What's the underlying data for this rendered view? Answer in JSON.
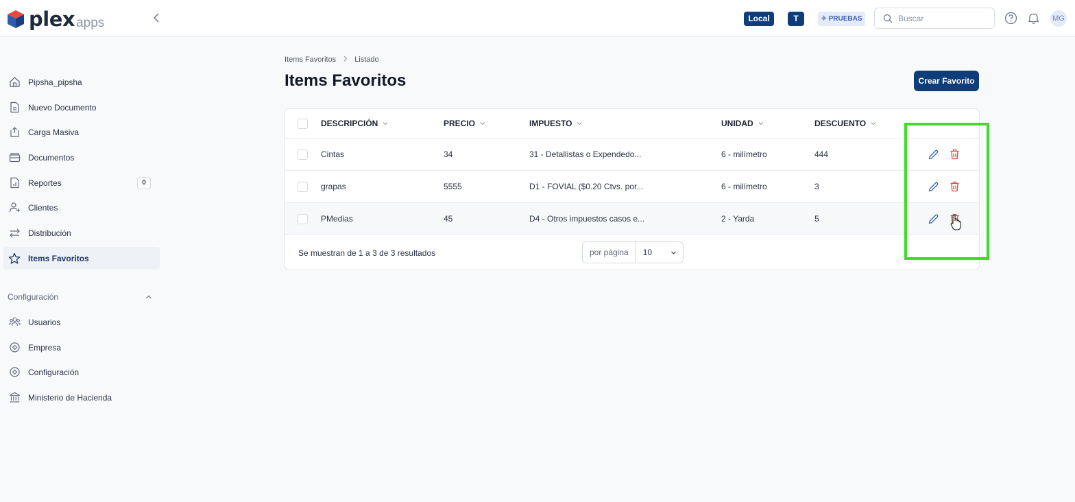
{
  "brand": {
    "name": "plex",
    "suffix": "apps"
  },
  "topbar": {
    "env_local": "Local",
    "env_t": "T",
    "env_pruebas": "✧ PRUEBAS",
    "search_placeholder": "Buscar",
    "avatar": "MG"
  },
  "sidebar": {
    "items": [
      {
        "label": "Pipsha_pipsha",
        "icon": "home-icon"
      },
      {
        "label": "Nuevo Documento",
        "icon": "document-icon"
      },
      {
        "label": "Carga Masiva",
        "icon": "upload-icon"
      },
      {
        "label": "Documentos",
        "icon": "folder-icon"
      },
      {
        "label": "Reportes",
        "icon": "report-icon",
        "badge": "0"
      },
      {
        "label": "Clientes",
        "icon": "add-user-icon"
      },
      {
        "label": "Distribución",
        "icon": "transfer-icon"
      },
      {
        "label": "Items Favoritos",
        "icon": "star-icon",
        "active": true
      }
    ],
    "config_section": "Configuración",
    "config_items": [
      {
        "label": "Usuarios",
        "icon": "users-icon"
      },
      {
        "label": "Empresa",
        "icon": "company-icon"
      },
      {
        "label": "Configuración",
        "icon": "settings-icon"
      },
      {
        "label": "Ministerio de Hacienda",
        "icon": "bank-icon"
      }
    ]
  },
  "breadcrumb": {
    "parent": "Items Favoritos",
    "current": "Listado"
  },
  "page_title": "Items Favoritos",
  "create_button": "Crear Favorito",
  "table": {
    "headers": {
      "description": "DESCRIPCIÓN",
      "price": "PRECIO",
      "tax": "IMPUESTO",
      "unit": "UNIDAD",
      "discount": "DESCUENTO"
    },
    "rows": [
      {
        "description": "Cintas",
        "price": "34",
        "tax": "31 - Detallistas o Expendedo...",
        "unit": "6 - milímetro",
        "discount": "444"
      },
      {
        "description": "grapas",
        "price": "5555",
        "tax": "D1 - FOVIAL ($0.20 Ctvs. por...",
        "unit": "6 - milímetro",
        "discount": "3"
      },
      {
        "description": "PMedias",
        "price": "45",
        "tax": "D4 - Otros impuestos casos e...",
        "unit": "2 - Yarda",
        "discount": "5"
      }
    ],
    "footer": "Se muestran de 1 a 3 de 3 resultados",
    "per_page_label": "por página",
    "per_page_value": "10"
  },
  "colors": {
    "primary": "#0e3d7a",
    "delete": "#e0483e",
    "highlight": "#3be01e"
  }
}
